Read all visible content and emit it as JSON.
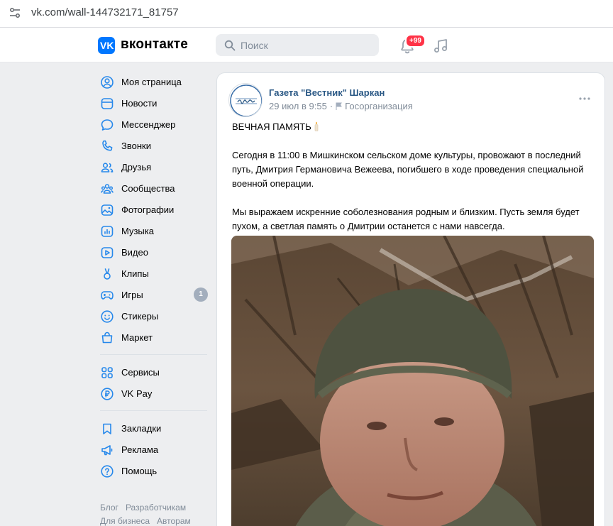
{
  "browser": {
    "url": "vk.com/wall-144732171_81757"
  },
  "header": {
    "logo_text": "вконтакте",
    "search_placeholder": "Поиск",
    "notifications_badge": "+99",
    "accent_color": "#0077ff"
  },
  "sidebar": {
    "items": [
      {
        "label": "Моя страница",
        "icon": "user-circle-icon"
      },
      {
        "label": "Новости",
        "icon": "news-icon"
      },
      {
        "label": "Мессенджер",
        "icon": "message-bubble-icon"
      },
      {
        "label": "Звонки",
        "icon": "phone-icon"
      },
      {
        "label": "Друзья",
        "icon": "friends-icon"
      },
      {
        "label": "Сообщества",
        "icon": "communities-icon"
      },
      {
        "label": "Фотографии",
        "icon": "photo-icon"
      },
      {
        "label": "Музыка",
        "icon": "music-icon"
      },
      {
        "label": "Видео",
        "icon": "video-icon"
      },
      {
        "label": "Клипы",
        "icon": "clips-icon"
      },
      {
        "label": "Игры",
        "icon": "gamepad-icon",
        "count": "1"
      },
      {
        "label": "Стикеры",
        "icon": "smile-icon"
      },
      {
        "label": "Маркет",
        "icon": "bag-icon"
      }
    ],
    "items2": [
      {
        "label": "Сервисы",
        "icon": "services-icon"
      },
      {
        "label": "VK Pay",
        "icon": "ruble-icon"
      }
    ],
    "items3": [
      {
        "label": "Закладки",
        "icon": "bookmark-icon"
      },
      {
        "label": "Реклама",
        "icon": "megaphone-icon"
      },
      {
        "label": "Помощь",
        "icon": "help-icon"
      }
    ],
    "footer": [
      "Блог",
      "Разработчикам",
      "Для бизнеса",
      "Авторам"
    ]
  },
  "post": {
    "author": "Газета \"Вестник\" Шаркан",
    "date": "29 июл в 9:55",
    "category": "Госорганизация",
    "title": "ВЕЧНАЯ ПАМЯТЬ",
    "paragraph1": "Сегодня в 11:00 в Мишкинском сельском доме культуры, провожают в последний путь, Дмитрия Германовича Вежеева, погибшего в ходе проведения специальной военной операции.",
    "paragraph2": "Мы выражаем искренние соболезнования родным и близким. Пусть земля будет пухом, а светлая память о Дмитрии останется с нами навсегда."
  }
}
